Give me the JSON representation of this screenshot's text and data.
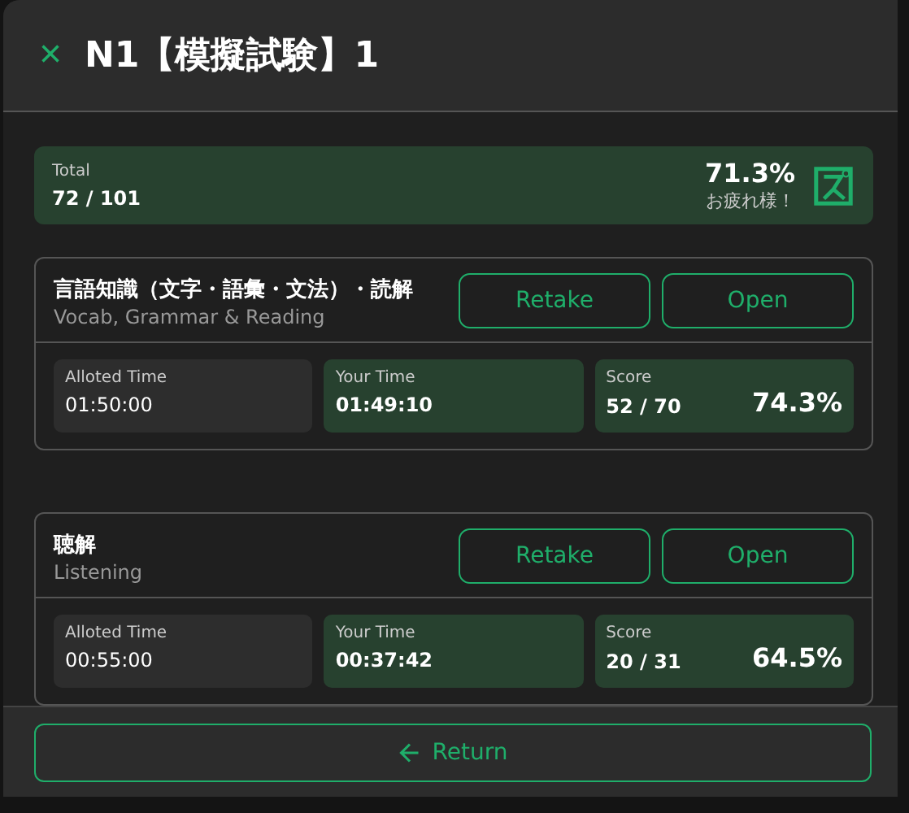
{
  "dialog": {
    "close": "×",
    "title": "N1【模擬試験】1"
  },
  "total": {
    "label": "Total",
    "value": "72 / 101",
    "percent": "71.3%",
    "message": "お疲れ様！"
  },
  "sections": [
    {
      "title": "言語知識（文字・語彙・文法）・読解",
      "subtitle": "Vocab, Grammar & Reading",
      "buttons": [
        "Retake",
        "Open"
      ],
      "stats": [
        {
          "kind": "plain",
          "label": "Alloted Time",
          "value": "01:50:00"
        },
        {
          "kind": "accent",
          "label": "Your Time",
          "value": "01:49:10"
        },
        {
          "kind": "score",
          "label": "Score",
          "value": "52 / 70",
          "percent": "74.3%"
        }
      ]
    },
    {
      "title": "聴解",
      "subtitle": "Listening",
      "buttons": [
        "Retake",
        "Open"
      ],
      "stats": [
        {
          "kind": "plain",
          "label": "Alloted Time",
          "value": "00:55:00"
        },
        {
          "kind": "accent",
          "label": "Your Time",
          "value": "00:37:42"
        },
        {
          "kind": "score",
          "label": "Score",
          "value": "20 / 31",
          "percent": "64.5%"
        }
      ]
    }
  ],
  "footer": {
    "button": "Return"
  }
}
